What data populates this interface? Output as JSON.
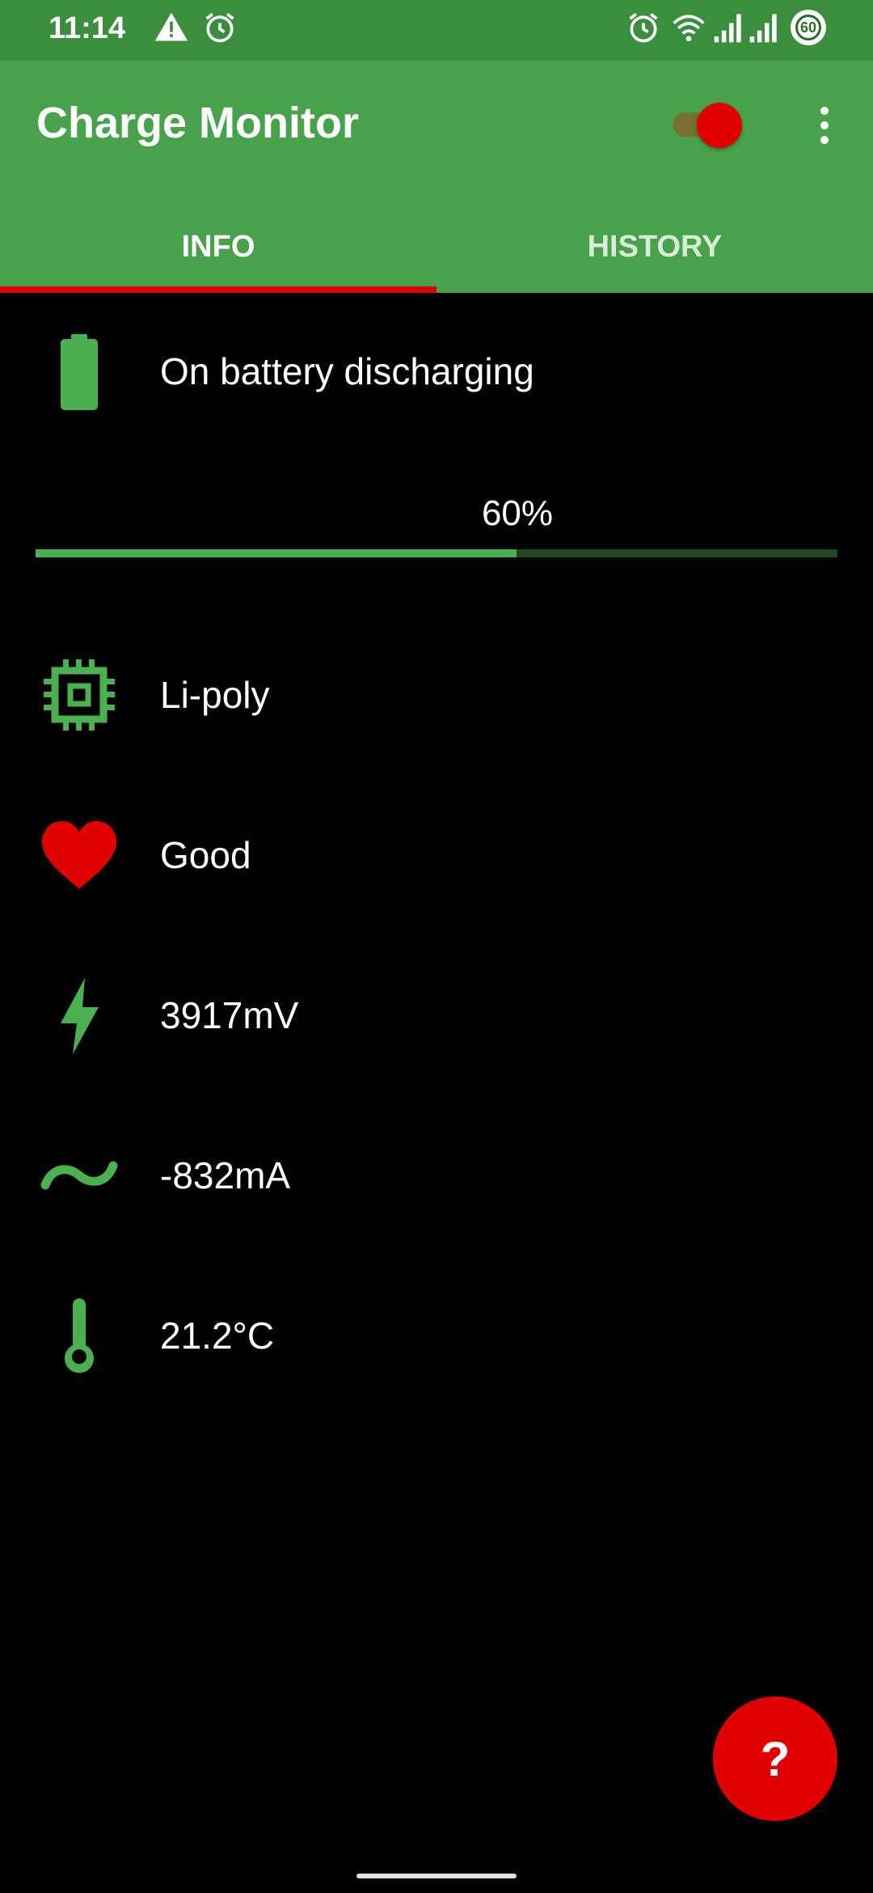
{
  "status_bar": {
    "time": "11:14",
    "battery_level": "60",
    "icons": [
      "warning-icon",
      "alarm-icon",
      "alarm-icon",
      "wifi-icon",
      "signal-icon",
      "signal-icon",
      "battery-level-icon"
    ]
  },
  "app_bar": {
    "title": "Charge Monitor",
    "toggle_on": true,
    "colors": {
      "primary": "#48a24c",
      "status": "#3b8e3e",
      "accent": "#e00000"
    }
  },
  "tabs": [
    {
      "label": "INFO",
      "selected": true
    },
    {
      "label": "HISTORY",
      "selected": false
    }
  ],
  "info": {
    "status": {
      "icon": "battery-icon",
      "text": "On battery discharging"
    },
    "level": {
      "text": "60%",
      "percent": 60
    },
    "technology": {
      "icon": "chip-icon",
      "text": "Li-poly"
    },
    "health": {
      "icon": "heart-icon",
      "text": "Good"
    },
    "voltage": {
      "icon": "lightning-icon",
      "text": "3917mV"
    },
    "current": {
      "icon": "wave-icon",
      "text": "-832mA"
    },
    "temperature": {
      "icon": "thermometer-icon",
      "text": "21.2°C"
    }
  },
  "fab": {
    "label": "?"
  }
}
